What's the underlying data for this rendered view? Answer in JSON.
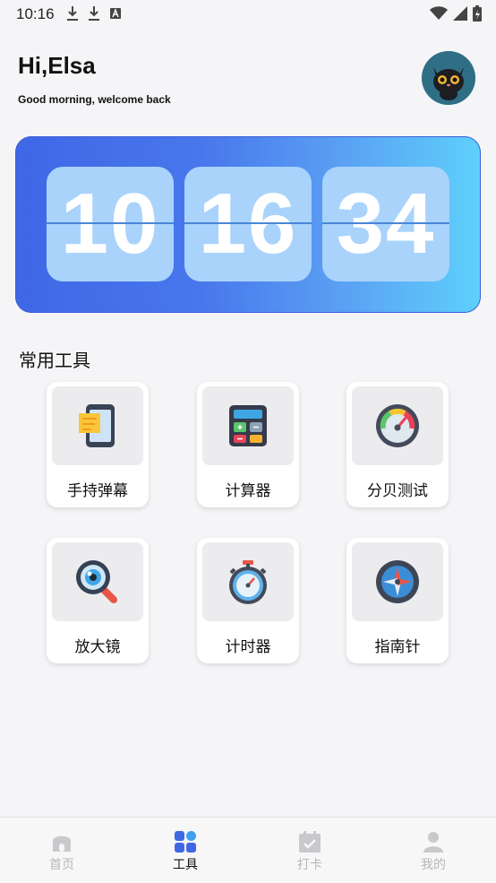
{
  "status_bar": {
    "time": "10:16"
  },
  "header": {
    "title": "Hi,Elsa",
    "subtitle": "Good morning, welcome back"
  },
  "clock": {
    "hours": "10",
    "minutes": "16",
    "seconds": "34"
  },
  "section": {
    "title": "常用工具"
  },
  "tools": [
    {
      "label": "手持弹幕",
      "icon": "phone-banner-icon"
    },
    {
      "label": "计算器",
      "icon": "calculator-icon"
    },
    {
      "label": "分贝测试",
      "icon": "decibel-meter-icon"
    },
    {
      "label": "放大镜",
      "icon": "magnifier-icon"
    },
    {
      "label": "计时器",
      "icon": "stopwatch-icon"
    },
    {
      "label": "指南针",
      "icon": "compass-icon"
    }
  ],
  "bottom_nav": {
    "items": [
      {
        "label": "首页",
        "icon": "home-icon",
        "active": false
      },
      {
        "label": "工具",
        "icon": "tools-icon",
        "active": true
      },
      {
        "label": "打卡",
        "icon": "checkin-icon",
        "active": false
      },
      {
        "label": "我的",
        "icon": "profile-icon",
        "active": false
      }
    ]
  },
  "colors": {
    "accent": "#3f67e6",
    "card_gradient_end": "#5ed0fb",
    "nav_inactive": "#b7b7bb"
  }
}
